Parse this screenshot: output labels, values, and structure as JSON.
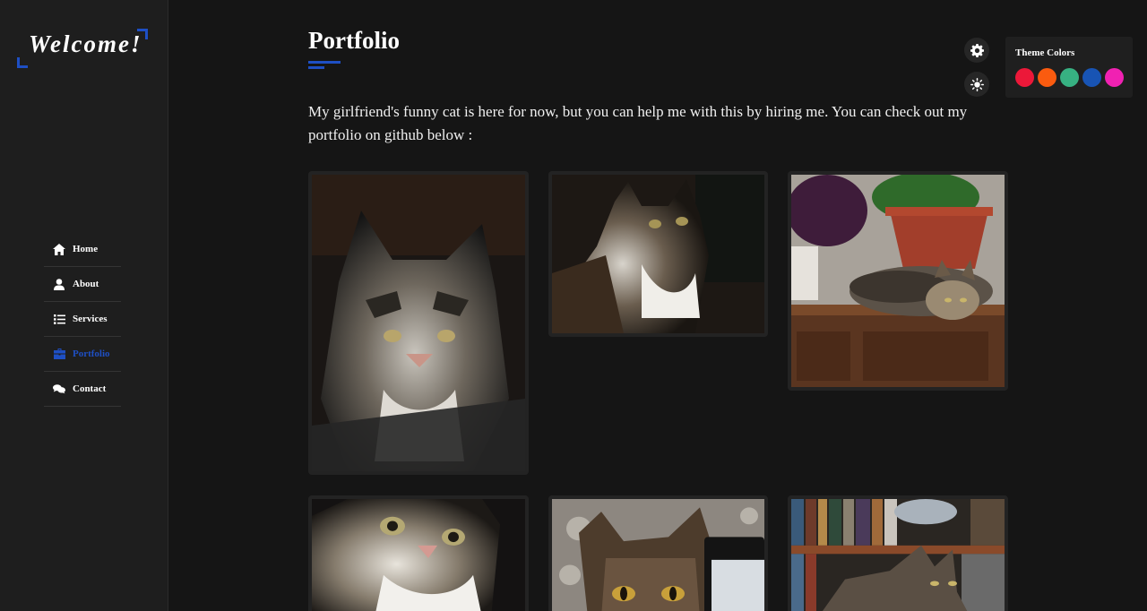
{
  "sidebar": {
    "logo_text": "Welcome!",
    "accent": "#1e4fc4",
    "items": [
      {
        "label": "Home",
        "icon": "home-icon",
        "active": false
      },
      {
        "label": "About",
        "icon": "user-icon",
        "active": false
      },
      {
        "label": "Services",
        "icon": "list-icon",
        "active": false
      },
      {
        "label": "Portfolio",
        "icon": "briefcase-icon",
        "active": true
      },
      {
        "label": "Contact",
        "icon": "comments-icon",
        "active": false
      }
    ]
  },
  "main": {
    "title": "Portfolio",
    "intro": "My girlfriend's funny cat is here for now, but you can help me with this by hiring me. You can check out my portfolio on github below :",
    "photos": [
      {
        "name": "cat-photo-1"
      },
      {
        "name": "cat-photo-2"
      },
      {
        "name": "cat-photo-3"
      },
      {
        "name": "cat-photo-4"
      },
      {
        "name": "cat-photo-5"
      },
      {
        "name": "cat-photo-6"
      }
    ]
  },
  "theme_panel": {
    "title": "Theme Colors",
    "colors": [
      "#ec1839",
      "#fa5b0f",
      "#37b182",
      "#1854b4",
      "#f021b2"
    ]
  }
}
